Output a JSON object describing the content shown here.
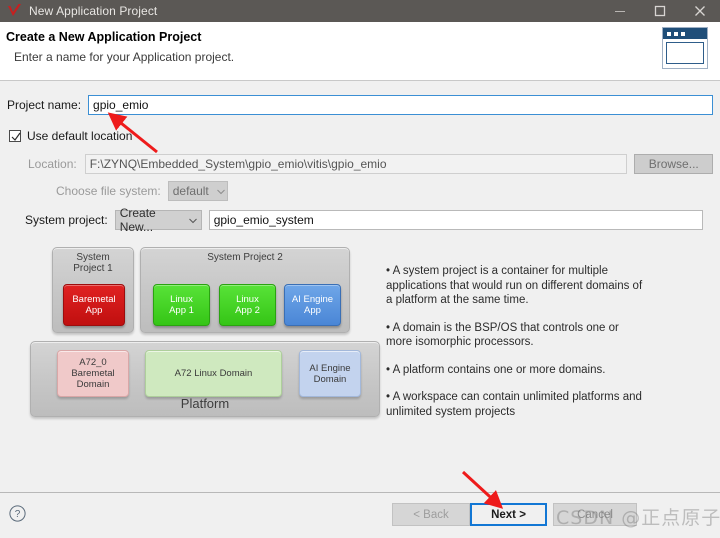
{
  "window": {
    "title": "New Application Project",
    "icon": "vitis-check-icon",
    "controls": {
      "minimize": "minimize-icon",
      "maximize": "maximize-icon",
      "close": "close-icon"
    }
  },
  "header": {
    "title": "Create a New Application Project",
    "subtitle": "Enter a name for your Application project.",
    "icon": "application-window-icon"
  },
  "form": {
    "project_name_label": "Project name:",
    "project_name_value": "gpio_emio",
    "use_default_location_label": "Use default location",
    "use_default_location_checked": true,
    "location_label": "Location:",
    "location_value": "F:\\ZYNQ\\Embedded_System\\gpio_emio\\vitis\\gpio_emio",
    "browse_label": "Browse...",
    "choose_fs_label": "Choose file system:",
    "choose_fs_value": "default",
    "system_project_label": "System project:",
    "system_project_select": "Create New...",
    "system_project_value": "gpio_emio_system"
  },
  "diagram": {
    "system_project_1": "System\nProject 1",
    "system_project_2": "System Project 2",
    "apps": [
      {
        "label": "Baremetal\nApp",
        "color": "#c00f0f"
      },
      {
        "label": "Linux\nApp 1",
        "color": "#35c516"
      },
      {
        "label": "Linux\nApp 2",
        "color": "#35c516"
      },
      {
        "label": "AI Engine\nApp",
        "color": "#4a86d6"
      }
    ],
    "domains": [
      {
        "label": "A72_0\nBaremetal\nDomain",
        "color": "#f0c9c9"
      },
      {
        "label": "A72 Linux Domain",
        "color": "#cfe9bf"
      },
      {
        "label": "AI Engine\nDomain",
        "color": "#c3d3ee"
      }
    ],
    "platform_label": "Platform"
  },
  "bullets": [
    "• A system project is a container for multiple\napplications that would run on different domains of\na platform at the same time.",
    "• A domain is the BSP/OS that controls one or\nmore isomorphic processors.",
    "• A platform contains one or more domains.",
    "• A workspace can contain unlimited platforms and\nunlimited system projects"
  ],
  "footer": {
    "help_icon": "help-question-icon",
    "back_label": "< Back",
    "next_label": "Next >",
    "cancel_label": "Cancel"
  },
  "overlay": {
    "watermark": "CSDN @正点原子",
    "annotation_arrows": [
      "arrow-to-project-name",
      "arrow-to-next-button"
    ]
  }
}
